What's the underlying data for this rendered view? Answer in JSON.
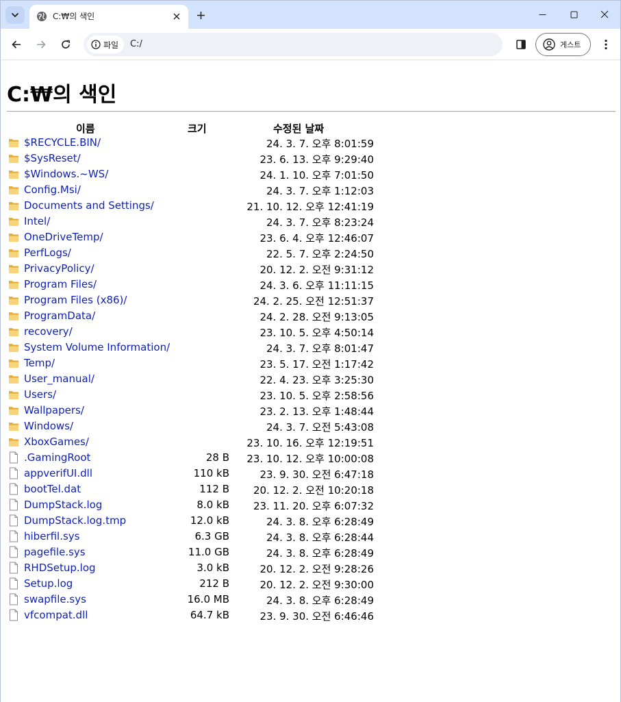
{
  "browser": {
    "tab": {
      "title": "C:₩의 색인"
    },
    "address": {
      "chip_label": "파일",
      "url": "C:/"
    },
    "profile": {
      "label": "게스트"
    }
  },
  "page": {
    "title": "C:₩의 색인",
    "columns": {
      "name": "이름",
      "size": "크기",
      "date": "수정된 날짜"
    },
    "entries": [
      {
        "name": "$RECYCLE.BIN/",
        "size": "",
        "date": "24. 3. 7. 오후 8:01:59",
        "kind": "folder"
      },
      {
        "name": "$SysReset/",
        "size": "",
        "date": "23. 6. 13. 오후 9:29:40",
        "kind": "folder"
      },
      {
        "name": "$Windows.~WS/",
        "size": "",
        "date": "24. 1. 10. 오후 7:01:50",
        "kind": "folder"
      },
      {
        "name": "Config.Msi/",
        "size": "",
        "date": "24. 3. 7. 오후 1:12:03",
        "kind": "folder"
      },
      {
        "name": "Documents and Settings/",
        "size": "",
        "date": "21. 10. 12. 오후 12:41:19",
        "kind": "folder"
      },
      {
        "name": "Intel/",
        "size": "",
        "date": "24. 3. 7. 오후 8:23:24",
        "kind": "folder"
      },
      {
        "name": "OneDriveTemp/",
        "size": "",
        "date": "23. 6. 4. 오후 12:46:07",
        "kind": "folder"
      },
      {
        "name": "PerfLogs/",
        "size": "",
        "date": "22. 5. 7. 오후 2:24:50",
        "kind": "folder"
      },
      {
        "name": "PrivacyPolicy/",
        "size": "",
        "date": "20. 12. 2. 오전 9:31:12",
        "kind": "folder"
      },
      {
        "name": "Program Files/",
        "size": "",
        "date": "24. 3. 6. 오후 11:11:15",
        "kind": "folder"
      },
      {
        "name": "Program Files (x86)/",
        "size": "",
        "date": "24. 2. 25. 오전 12:51:37",
        "kind": "folder"
      },
      {
        "name": "ProgramData/",
        "size": "",
        "date": "24. 2. 28. 오전 9:13:05",
        "kind": "folder"
      },
      {
        "name": "recovery/",
        "size": "",
        "date": "23. 10. 5. 오후 4:50:14",
        "kind": "folder"
      },
      {
        "name": "System Volume Information/",
        "size": "",
        "date": "24. 3. 7. 오후 8:01:47",
        "kind": "folder"
      },
      {
        "name": "Temp/",
        "size": "",
        "date": "23. 5. 17. 오전 1:17:42",
        "kind": "folder"
      },
      {
        "name": "User_manual/",
        "size": "",
        "date": "22. 4. 23. 오후 3:25:30",
        "kind": "folder"
      },
      {
        "name": "Users/",
        "size": "",
        "date": "23. 10. 5. 오후 2:58:56",
        "kind": "folder"
      },
      {
        "name": "Wallpapers/",
        "size": "",
        "date": "23. 2. 13. 오후 1:48:44",
        "kind": "folder"
      },
      {
        "name": "Windows/",
        "size": "",
        "date": "24. 3. 7. 오전 5:43:08",
        "kind": "folder"
      },
      {
        "name": "XboxGames/",
        "size": "",
        "date": "23. 10. 16. 오후 12:19:51",
        "kind": "folder"
      },
      {
        "name": ".GamingRoot",
        "size": "28 B",
        "date": "23. 10. 12. 오후 10:00:08",
        "kind": "file"
      },
      {
        "name": "appverifUI.dll",
        "size": "110 kB",
        "date": "23. 9. 30. 오전 6:47:18",
        "kind": "file"
      },
      {
        "name": "bootTel.dat",
        "size": "112 B",
        "date": "20. 12. 2. 오전 10:20:18",
        "kind": "file"
      },
      {
        "name": "DumpStack.log",
        "size": "8.0 kB",
        "date": "23. 11. 20. 오후 6:07:32",
        "kind": "file"
      },
      {
        "name": "DumpStack.log.tmp",
        "size": "12.0 kB",
        "date": "24. 3. 8. 오후 6:28:49",
        "kind": "file"
      },
      {
        "name": "hiberfil.sys",
        "size": "6.3 GB",
        "date": "24. 3. 8. 오후 6:28:44",
        "kind": "file"
      },
      {
        "name": "pagefile.sys",
        "size": "11.0 GB",
        "date": "24. 3. 8. 오후 6:28:49",
        "kind": "file"
      },
      {
        "name": "RHDSetup.log",
        "size": "3.0 kB",
        "date": "20. 12. 2. 오전 9:28:26",
        "kind": "file"
      },
      {
        "name": "Setup.log",
        "size": "212 B",
        "date": "20. 12. 2. 오전 9:30:00",
        "kind": "file"
      },
      {
        "name": "swapfile.sys",
        "size": "16.0 MB",
        "date": "24. 3. 8. 오후 6:28:49",
        "kind": "file"
      },
      {
        "name": "vfcompat.dll",
        "size": "64.7 kB",
        "date": "23. 9. 30. 오전 6:46:46",
        "kind": "file"
      }
    ]
  }
}
